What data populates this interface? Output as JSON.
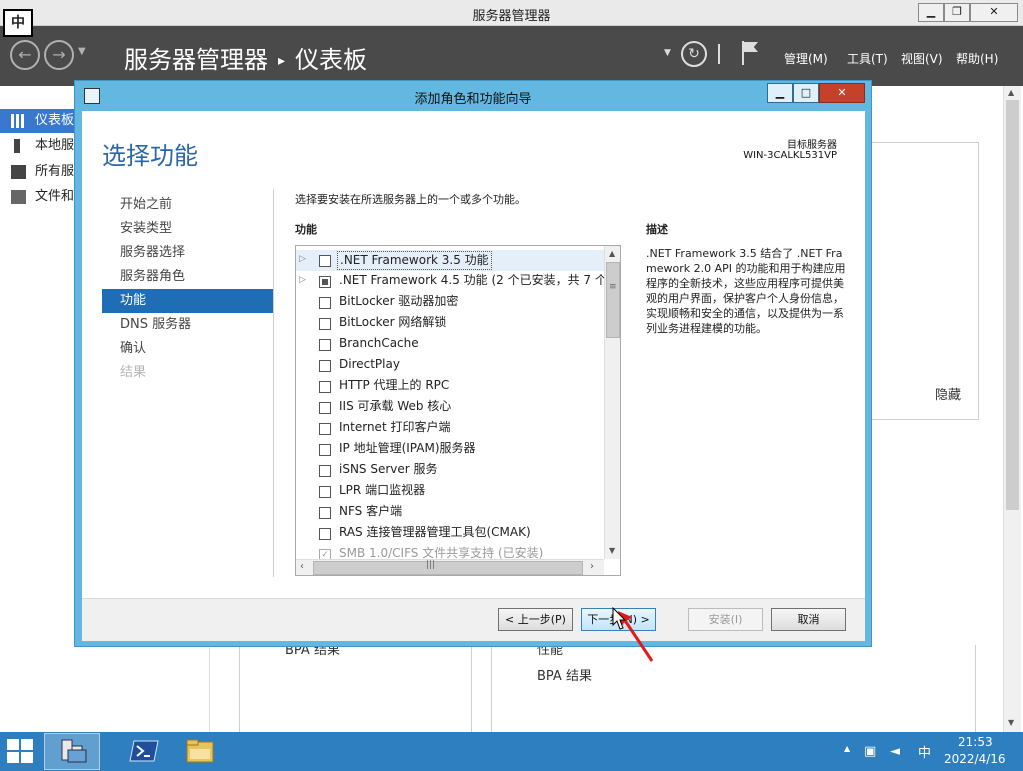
{
  "window": {
    "title": "服务器管理器",
    "ime_indicator": "中",
    "controls": {
      "minimize": "▁",
      "maximize": "❐",
      "close": "✕"
    }
  },
  "header": {
    "breadcrumb_app": "服务器管理器",
    "breadcrumb_sep": "▸",
    "breadcrumb_page": "仪表板",
    "menus": [
      "管理(M)",
      "工具(T)",
      "视图(V)",
      "帮助(H)"
    ]
  },
  "sidebar": {
    "items": [
      {
        "label": "仪表板",
        "icon": "dashboard-icon",
        "active": true
      },
      {
        "label": "本地服",
        "icon": "local-server-icon"
      },
      {
        "label": "所有服",
        "icon": "all-servers-icon"
      },
      {
        "label": "文件和",
        "icon": "file-services-icon"
      }
    ]
  },
  "dashboard": {
    "hide_label": "隐藏",
    "bpa_left": "BPA 结果",
    "perf_right": "性能",
    "bpa_right": "BPA 结果"
  },
  "wizard": {
    "title": "添加角色和功能向导",
    "heading": "选择功能",
    "target_label": "目标服务器",
    "target_name": "WIN-3CALKL531VP",
    "steps": [
      {
        "label": "开始之前",
        "state": "normal"
      },
      {
        "label": "安装类型",
        "state": "normal"
      },
      {
        "label": "服务器选择",
        "state": "normal"
      },
      {
        "label": "服务器角色",
        "state": "normal"
      },
      {
        "label": "功能",
        "state": "active"
      },
      {
        "label": "DNS 服务器",
        "state": "normal"
      },
      {
        "label": "确认",
        "state": "normal"
      },
      {
        "label": "结果",
        "state": "disabled"
      }
    ],
    "instruction": "选择要安装在所选服务器上的一个或多个功能。",
    "features_header": "功能",
    "description_header": "描述",
    "description": ".NET Framework 3.5 结合了 .NET Framework 2.0 API 的功能和用于构建应用程序的全新技术，这些应用程序可提供美观的用户界面，保护客户个人身份信息，实现顺畅和安全的通信，以及提供为一系列业务进程建模的功能。",
    "features": [
      {
        "label": ".NET Framework 3.5 功能",
        "expandable": true,
        "selected": true,
        "state": "unchecked"
      },
      {
        "label": ".NET Framework 4.5 功能 (2 个已安装，共 7 个)",
        "expandable": true,
        "state": "partial"
      },
      {
        "label": "BitLocker 驱动器加密",
        "state": "unchecked"
      },
      {
        "label": "BitLocker 网络解锁",
        "state": "unchecked"
      },
      {
        "label": "BranchCache",
        "state": "unchecked"
      },
      {
        "label": "DirectPlay",
        "state": "unchecked"
      },
      {
        "label": "HTTP 代理上的 RPC",
        "state": "unchecked"
      },
      {
        "label": "IIS 可承载 Web 核心",
        "state": "unchecked"
      },
      {
        "label": "Internet 打印客户端",
        "state": "unchecked"
      },
      {
        "label": "IP 地址管理(IPAM)服务器",
        "state": "unchecked"
      },
      {
        "label": "iSNS Server 服务",
        "state": "unchecked"
      },
      {
        "label": "LPR 端口监视器",
        "state": "unchecked"
      },
      {
        "label": "NFS 客户端",
        "state": "unchecked"
      },
      {
        "label": "RAS 连接管理器管理工具包(CMAK)",
        "state": "unchecked"
      },
      {
        "label": "SMB 1.0/CIFS 文件共享支持 (已安装)",
        "state": "checked",
        "cut_off": true
      }
    ],
    "buttons": {
      "prev": "< 上一步(P)",
      "next": "下一步(N) >",
      "install": "安装(I)",
      "cancel": "取消"
    }
  },
  "taskbar": {
    "clock_time": "21:53",
    "clock_date": "2022/4/16",
    "ime": "中",
    "tray_chevron": "▲"
  },
  "colors": {
    "accent": "#1f6db4",
    "header_bg": "#4a4a4a",
    "dialog_frame": "#62b8e0",
    "taskbar": "#2d7fbf",
    "annotation_arrow": "#e21a1a"
  }
}
